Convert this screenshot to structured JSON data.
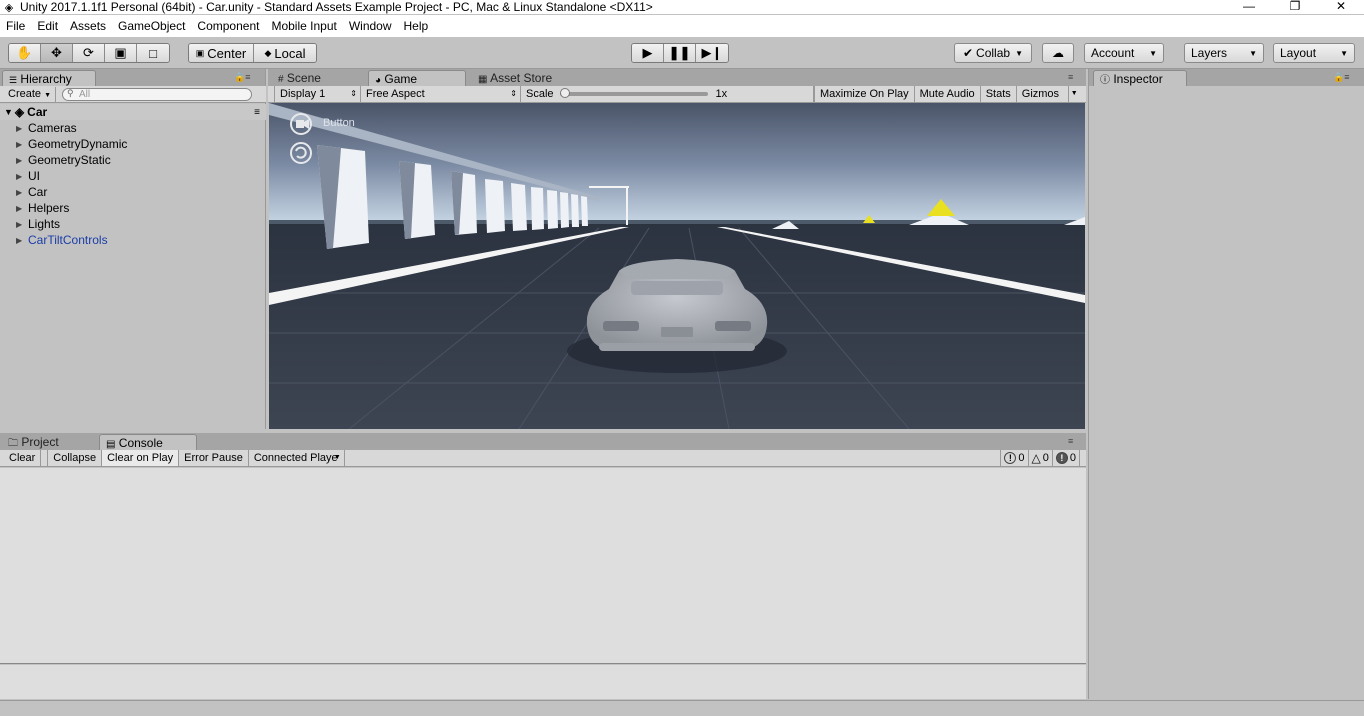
{
  "window": {
    "title": "Unity 2017.1.1f1 Personal (64bit) - Car.unity - Standard Assets Example Project - PC, Mac & Linux Standalone <DX11>"
  },
  "menu": [
    "File",
    "Edit",
    "Assets",
    "GameObject",
    "Component",
    "Mobile Input",
    "Window",
    "Help"
  ],
  "toolbar": {
    "pivot_label": "Center",
    "space_label": "Local",
    "collab_label": "Collab",
    "account_label": "Account",
    "layers_label": "Layers",
    "layout_label": "Layout"
  },
  "hierarchy": {
    "tab_label": "Hierarchy",
    "create_label": "Create",
    "search_placeholder": "All",
    "scene_name": "Car",
    "items": [
      {
        "label": "Cameras",
        "prefab": false
      },
      {
        "label": "GeometryDynamic",
        "prefab": false
      },
      {
        "label": "GeometryStatic",
        "prefab": false
      },
      {
        "label": "UI",
        "prefab": false
      },
      {
        "label": "Car",
        "prefab": false
      },
      {
        "label": "Helpers",
        "prefab": false
      },
      {
        "label": "Lights",
        "prefab": false
      },
      {
        "label": "CarTiltControls",
        "prefab": true
      }
    ]
  },
  "view": {
    "tabs": [
      "Scene",
      "Game",
      "Asset Store"
    ],
    "active_tab": "Game",
    "display_label": "Display 1",
    "aspect_label": "Free Aspect",
    "scale_label": "Scale",
    "scale_value": "1x",
    "scale_fraction": 0.0,
    "maximize_label": "Maximize On Play",
    "mute_label": "Mute Audio",
    "stats_label": "Stats",
    "gizmos_label": "Gizmos",
    "overlay_button_label": "Button"
  },
  "inspector": {
    "tab_label": "Inspector"
  },
  "console": {
    "tabs": [
      "Project",
      "Console"
    ],
    "active_tab": "Console",
    "buttons": [
      "Clear",
      "Collapse",
      "Clear on Play",
      "Error Pause",
      "Connected Playe"
    ],
    "info_count": "0",
    "warning_count": "0",
    "error_count": "0"
  },
  "colors": {
    "sky_top": "#4a5468",
    "sky_bottom": "#c9d8e6",
    "road": "#3b4250",
    "panel_bg": "#c2c2c2",
    "prefab_text": "#1a3da8"
  }
}
